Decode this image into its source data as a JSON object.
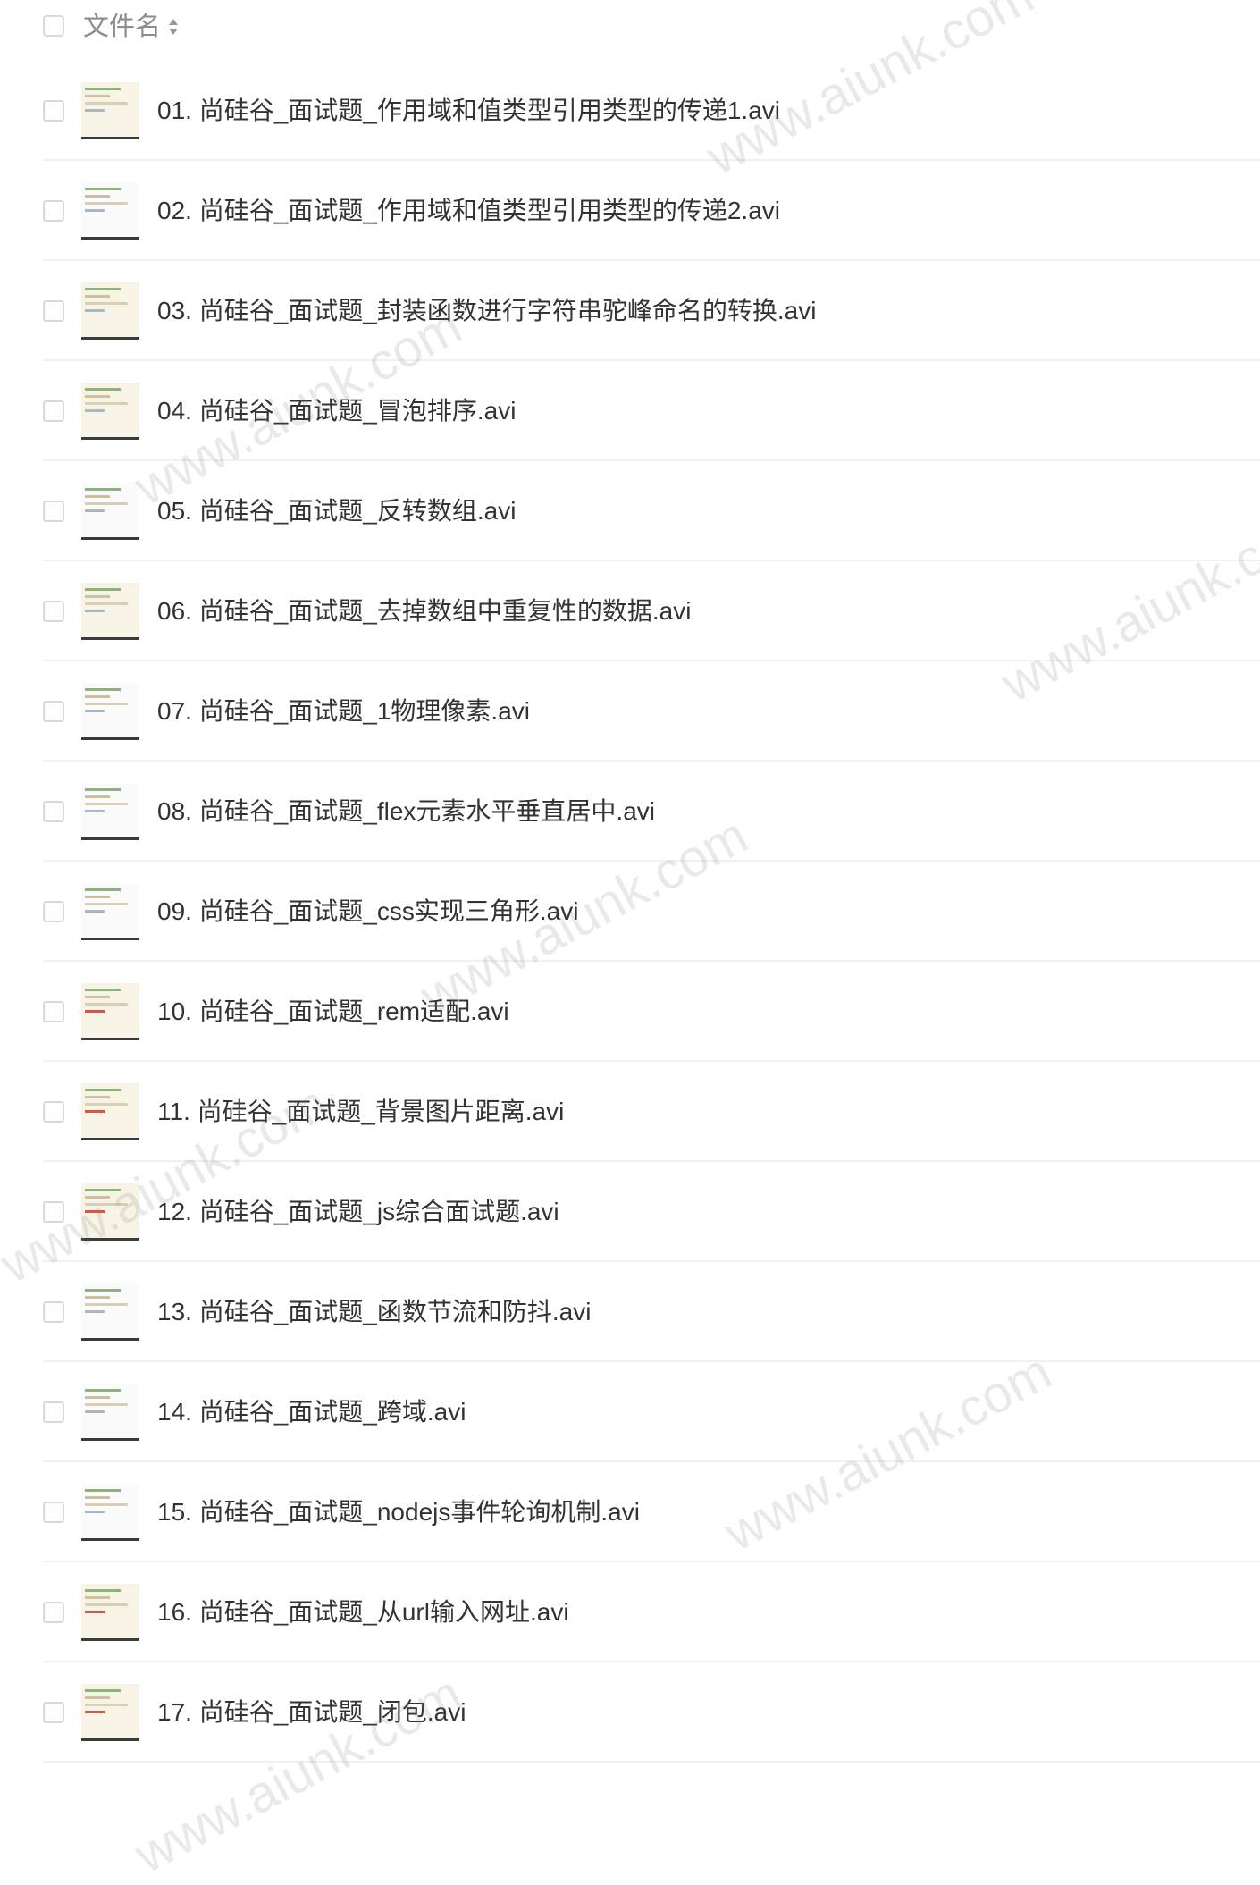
{
  "header": {
    "label": "文件名"
  },
  "files": [
    {
      "name": "01. 尚硅谷_面试题_作用域和值类型引用类型的传递1.avi"
    },
    {
      "name": "02. 尚硅谷_面试题_作用域和值类型引用类型的传递2.avi"
    },
    {
      "name": "03. 尚硅谷_面试题_封装函数进行字符串驼峰命名的转换.avi"
    },
    {
      "name": "04. 尚硅谷_面试题_冒泡排序.avi"
    },
    {
      "name": "05. 尚硅谷_面试题_反转数组.avi"
    },
    {
      "name": "06. 尚硅谷_面试题_去掉数组中重复性的数据.avi"
    },
    {
      "name": "07. 尚硅谷_面试题_1物理像素.avi"
    },
    {
      "name": "08. 尚硅谷_面试题_flex元素水平垂直居中.avi"
    },
    {
      "name": "09. 尚硅谷_面试题_css实现三角形.avi"
    },
    {
      "name": "10. 尚硅谷_面试题_rem适配.avi"
    },
    {
      "name": "11. 尚硅谷_面试题_背景图片距离.avi"
    },
    {
      "name": "12. 尚硅谷_面试题_js综合面试题.avi"
    },
    {
      "name": "13. 尚硅谷_面试题_函数节流和防抖.avi"
    },
    {
      "name": "14. 尚硅谷_面试题_跨域.avi"
    },
    {
      "name": "15. 尚硅谷_面试题_nodejs事件轮询机制.avi"
    },
    {
      "name": "16. 尚硅谷_面试题_从url输入网址.avi"
    },
    {
      "name": "17. 尚硅谷_面试题_闭包.avi"
    }
  ],
  "watermark_text": "www.aiunk.com",
  "colors": {
    "text": "#333333",
    "header_text": "#8c8c8c",
    "divider": "#f0f0f0",
    "checkbox_border": "#d9d9d9"
  }
}
